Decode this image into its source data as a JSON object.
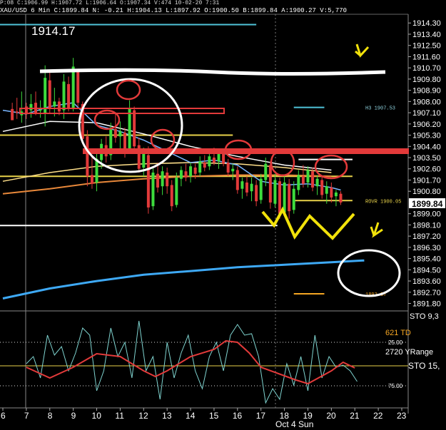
{
  "header": {
    "line1": "XAU/USD 6 Min  C:1899.84  N: -0.21  H:1904.13  L:1897.92  O:1900.50  B:1899.84  A:1900.27  V:5,770",
    "line2": "P:08  C:1906.99  H:1907.72  L:1906.64  O:1907.34  V:474  10-02-20  7:31"
  },
  "chart_data": {
    "type": "line",
    "price_axis": {
      "ticks": [
        "1914.30",
        "1913.40",
        "1912.50",
        "1911.60",
        "1910.70",
        "1909.80",
        "1908.90",
        "1908.00",
        "1907.10",
        "1906.20",
        "1905.30",
        "1904.40",
        "1903.50",
        "1902.60",
        "1901.70",
        "1900.80",
        "1899.00",
        "1898.10",
        "1897.20",
        "1896.30",
        "1895.40",
        "1894.50",
        "1893.60",
        "1892.70",
        "1891.80"
      ],
      "current_price": "1899.84",
      "range": [
        1891.2,
        1915.0
      ]
    },
    "x_axis": {
      "ticks": [
        "6",
        "7",
        "8",
        "9",
        "10",
        "11",
        "12",
        "13",
        "14",
        "15",
        "16",
        "17",
        "18",
        "19",
        "20",
        "21",
        "22",
        "23"
      ],
      "date_label": "Oct 4 Sun"
    },
    "labels": {
      "high_label": "1914.17",
      "h3_label": "H3 1907.53",
      "rovr_label": "ROVR 1900.05",
      "low_label": "1892.57"
    },
    "levels": [
      {
        "price": 1914.17,
        "color": "#4fc3d9",
        "from": 0,
        "to": 16.8
      },
      {
        "price": 1907.53,
        "color": "#4fc3d9",
        "from": 18.4,
        "to": 19.7
      },
      {
        "price": 1905.3,
        "color": "#e8d24a",
        "from": -1,
        "to": 15.8
      },
      {
        "price": 1903.35,
        "color": "#ffffff",
        "from": 18.6,
        "to": 20.9
      },
      {
        "price": 1902.0,
        "color": "#e8d24a",
        "from": -1,
        "to": 20.9
      },
      {
        "price": 1900.05,
        "color": "#e8d24a",
        "from": 18.4,
        "to": 20.9
      },
      {
        "price": 1898.05,
        "color": "#ffffff",
        "from": -1,
        "to": 17.7
      },
      {
        "price": 1892.57,
        "color": "#f5a623",
        "from": 18.4,
        "to": 19.7
      }
    ],
    "candles": [
      [
        6.4,
        1907.4,
        1907.9,
        1907.2,
        1906.5
      ],
      [
        6.6,
        1907.2,
        1908.3,
        1906.6,
        1907.1
      ],
      [
        6.8,
        1906.9,
        1908.8,
        1906.3,
        1907.2
      ],
      [
        7.0,
        1907.6,
        1907.9,
        1906.6,
        1907.0
      ],
      [
        7.2,
        1907.3,
        1908.6,
        1906.7,
        1907.8
      ],
      [
        7.4,
        1907.9,
        1908.8,
        1906.9,
        1907.1
      ],
      [
        7.6,
        1907.3,
        1908.1,
        1906.7,
        1907.3
      ],
      [
        7.8,
        1907.1,
        1910.9,
        1906.0,
        1909.9
      ],
      [
        8.0,
        1909.7,
        1910.4,
        1907.0,
        1907.5
      ],
      [
        8.2,
        1907.6,
        1909.1,
        1906.8,
        1908.0
      ],
      [
        8.4,
        1908.0,
        1908.3,
        1906.9,
        1907.2
      ],
      [
        8.6,
        1907.3,
        1910.2,
        1906.6,
        1909.6
      ],
      [
        8.8,
        1909.4,
        1910.0,
        1907.2,
        1907.4
      ],
      [
        9.0,
        1907.5,
        1911.5,
        1907.2,
        1910.8
      ],
      [
        9.2,
        1910.4,
        1910.6,
        1907.6,
        1907.9
      ],
      [
        9.4,
        1907.8,
        1908.0,
        1904.6,
        1905.0
      ],
      [
        9.6,
        1905.2,
        1905.7,
        1901.2,
        1902.0
      ],
      [
        9.8,
        1902.1,
        1903.6,
        1901.0,
        1901.4
      ],
      [
        10.0,
        1901.5,
        1903.9,
        1900.8,
        1903.4
      ],
      [
        10.2,
        1903.3,
        1905.0,
        1902.6,
        1904.6
      ],
      [
        10.4,
        1904.5,
        1905.2,
        1903.1,
        1903.6
      ],
      [
        10.6,
        1903.7,
        1906.3,
        1903.3,
        1905.9
      ],
      [
        10.8,
        1905.8,
        1907.0,
        1904.7,
        1905.1
      ],
      [
        11.0,
        1905.2,
        1906.4,
        1904.0,
        1905.6
      ],
      [
        11.2,
        1905.5,
        1905.9,
        1903.5,
        1904.0
      ],
      [
        11.4,
        1904.1,
        1908.1,
        1903.9,
        1907.4
      ],
      [
        11.6,
        1907.3,
        1907.6,
        1904.1,
        1904.4
      ],
      [
        11.8,
        1904.5,
        1905.1,
        1902.3,
        1902.6
      ],
      [
        12.0,
        1902.7,
        1904.3,
        1902.0,
        1903.8
      ],
      [
        12.2,
        1903.7,
        1904.4,
        1899.0,
        1899.5
      ],
      [
        12.4,
        1899.6,
        1902.8,
        1899.3,
        1902.3
      ],
      [
        12.6,
        1902.2,
        1903.1,
        1900.7,
        1901.1
      ],
      [
        12.8,
        1901.2,
        1902.8,
        1900.5,
        1902.4
      ],
      [
        13.0,
        1902.3,
        1902.7,
        1900.6,
        1901.2
      ],
      [
        13.2,
        1901.3,
        1901.7,
        1899.2,
        1899.6
      ],
      [
        13.4,
        1899.7,
        1902.3,
        1899.5,
        1901.9
      ],
      [
        13.6,
        1901.8,
        1902.8,
        1901.2,
        1902.5
      ],
      [
        13.8,
        1902.4,
        1903.0,
        1901.6,
        1901.9
      ],
      [
        14.0,
        1902.0,
        1903.1,
        1901.5,
        1902.8
      ],
      [
        14.2,
        1902.7,
        1903.0,
        1901.8,
        1902.2
      ],
      [
        14.4,
        1902.3,
        1903.6,
        1902.0,
        1903.2
      ],
      [
        14.6,
        1903.1,
        1903.7,
        1902.4,
        1902.7
      ],
      [
        14.8,
        1902.8,
        1904.0,
        1902.5,
        1903.6
      ],
      [
        15.0,
        1903.5,
        1904.3,
        1902.9,
        1903.1
      ],
      [
        15.2,
        1903.2,
        1904.0,
        1902.6,
        1903.9
      ],
      [
        15.4,
        1903.8,
        1904.1,
        1902.8,
        1903.0
      ],
      [
        15.6,
        1903.1,
        1903.4,
        1902.0,
        1902.3
      ],
      [
        15.8,
        1902.4,
        1903.0,
        1901.7,
        1902.6
      ],
      [
        16.0,
        1902.5,
        1902.8,
        1900.6,
        1900.9
      ],
      [
        16.2,
        1901.0,
        1901.9,
        1900.2,
        1901.6
      ],
      [
        16.4,
        1901.5,
        1902.0,
        1900.4,
        1900.7
      ],
      [
        16.6,
        1900.8,
        1901.9,
        1900.0,
        1901.4
      ],
      [
        16.8,
        1901.3,
        1901.7,
        1899.6,
        1900.0
      ],
      [
        17.0,
        1900.1,
        1902.2,
        1899.8,
        1901.8
      ],
      [
        17.2,
        1901.7,
        1903.5,
        1901.2,
        1903.0
      ],
      [
        17.4,
        1902.9,
        1903.2,
        1899.4,
        1899.9
      ],
      [
        17.6,
        1899.8,
        1902.2,
        1899.5,
        1901.7
      ],
      [
        17.8,
        1901.6,
        1901.9,
        1898.6,
        1899.0
      ],
      [
        18.0,
        1899.1,
        1902.0,
        1898.8,
        1901.5
      ],
      [
        18.2,
        1901.4,
        1901.8,
        1898.6,
        1899.2
      ],
      [
        18.4,
        1899.3,
        1901.6,
        1899.0,
        1901.0
      ],
      [
        18.6,
        1900.9,
        1902.5,
        1900.5,
        1902.1
      ],
      [
        18.8,
        1902.0,
        1902.9,
        1901.1,
        1901.4
      ],
      [
        19.0,
        1901.5,
        1902.8,
        1901.1,
        1902.5
      ],
      [
        19.2,
        1902.4,
        1902.7,
        1900.8,
        1901.1
      ],
      [
        19.4,
        1901.2,
        1902.1,
        1900.5,
        1901.8
      ],
      [
        19.6,
        1901.7,
        1902.0,
        1900.2,
        1900.5
      ],
      [
        19.8,
        1900.6,
        1901.6,
        1899.8,
        1901.2
      ],
      [
        20.0,
        1901.1,
        1901.5,
        1899.9,
        1900.3
      ],
      [
        20.2,
        1900.4,
        1900.9,
        1899.6,
        1900.7
      ],
      [
        20.4,
        1900.6,
        1900.8,
        1899.7,
        1899.9
      ]
    ],
    "stochastic": {
      "label": "STO 9,3",
      "label2": "STO 15,",
      "ticks": [
        "25.00",
        "75.00"
      ],
      "td_label": "621 TD",
      "yrange_label": "2720 YRange"
    }
  }
}
